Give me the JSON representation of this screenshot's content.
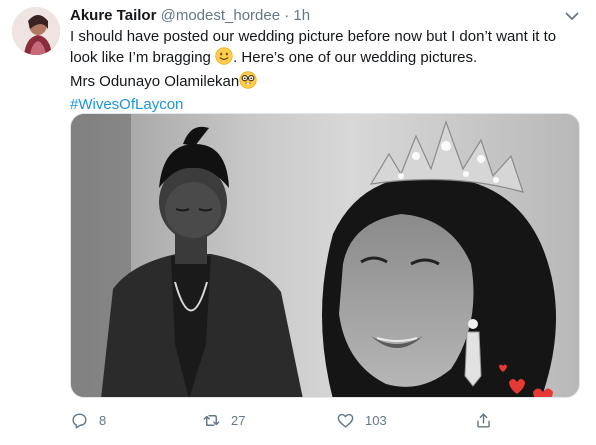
{
  "tweet": {
    "author_name": "Akure Tailor",
    "handle": "@modest_hordee",
    "separator": "·",
    "time": "1h",
    "text_line1": "I should have posted our wedding picture before now but I don’t want it to",
    "text_line2a": "look like I’m bragging",
    "text_line2b": ". Here’s one of our wedding pictures.",
    "text_line3": "Mrs Odunayo Olamilekan",
    "hashtag": "#WivesOfLaycon"
  },
  "actions": {
    "reply_count": "8",
    "retweet_count": "27",
    "like_count": "103"
  },
  "icons": {
    "caret": "chevron-down-icon",
    "reply": "reply-icon",
    "retweet": "retweet-icon",
    "like": "heart-icon",
    "share": "share-icon",
    "emoji1": "slightly-smiling-face-emoji",
    "emoji2": "nerd-face-emoji"
  },
  "colors": {
    "link": "#1b95e0",
    "muted": "#657786",
    "text": "#14171a"
  }
}
